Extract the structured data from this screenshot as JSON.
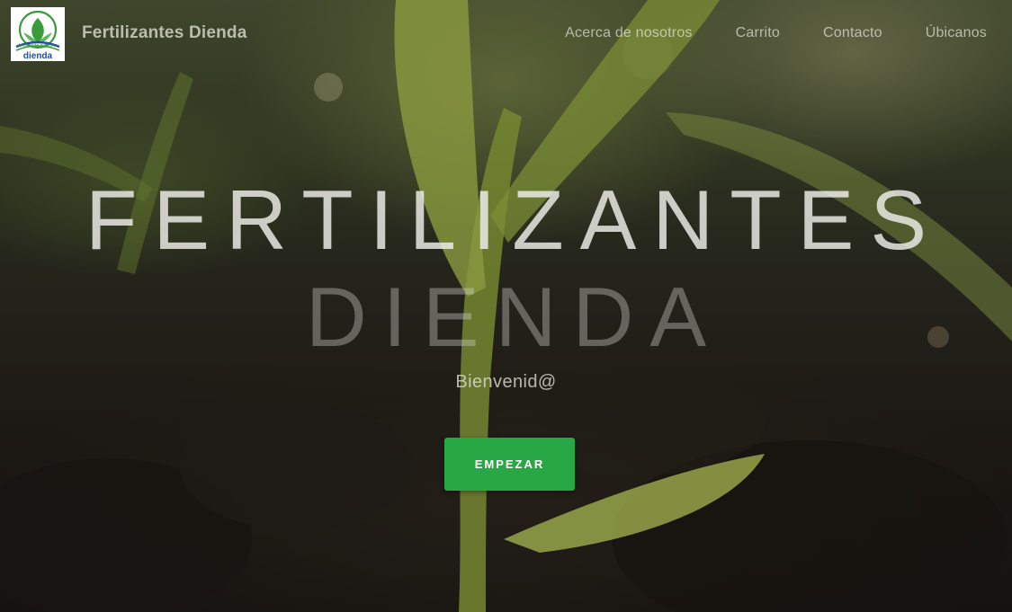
{
  "navbar": {
    "brand_name": "Fertilizantes Dienda",
    "logo_text_top": "fertilizante orgánico",
    "logo_text_bottom": "dienda",
    "links": [
      {
        "label": "Acerca de nosotros"
      },
      {
        "label": "Carrito"
      },
      {
        "label": "Contacto"
      },
      {
        "label": "Úbicanos"
      }
    ]
  },
  "hero": {
    "title_line_1": "FERTILIZANTES",
    "title_line_2": "DIENDA",
    "subtitle": "Bienvenid@",
    "cta_label": "EMPEZAR"
  },
  "colors": {
    "cta_background": "#28a745",
    "logo_green": "#3a9a3c",
    "logo_blue": "#1f4f9c"
  }
}
